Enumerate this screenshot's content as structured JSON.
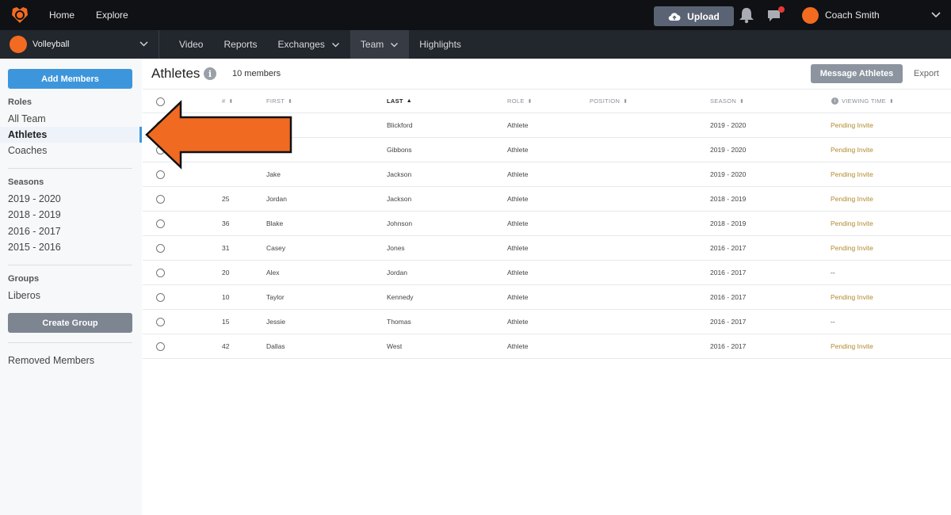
{
  "topbar": {
    "nav": [
      "Home",
      "Explore"
    ],
    "upload_label": "Upload",
    "user_name": "Coach Smith"
  },
  "subbar": {
    "team_name": "Volleyball",
    "nav": [
      {
        "label": "Video",
        "dropdown": false,
        "active": false
      },
      {
        "label": "Reports",
        "dropdown": false,
        "active": false
      },
      {
        "label": "Exchanges",
        "dropdown": true,
        "active": false
      },
      {
        "label": "Team",
        "dropdown": true,
        "active": true
      },
      {
        "label": "Highlights",
        "dropdown": false,
        "active": false
      }
    ]
  },
  "sidebar": {
    "add_members_label": "Add Members",
    "roles_heading": "Roles",
    "roles": [
      "All Team",
      "Athletes",
      "Coaches"
    ],
    "seasons_heading": "Seasons",
    "seasons": [
      "2019 - 2020",
      "2018 - 2019",
      "2016 - 2017",
      "2015 - 2016"
    ],
    "groups_heading": "Groups",
    "groups": [
      "Liberos"
    ],
    "create_group_label": "Create Group",
    "removed_members_label": "Removed Members"
  },
  "main": {
    "title": "Athletes",
    "member_count": "10 members",
    "message_label": "Message Athletes",
    "export_label": "Export",
    "columns": [
      "#",
      "FIRST",
      "LAST",
      "ROLE",
      "POSITION",
      "SEASON",
      "VIEWING TIME"
    ],
    "rows": [
      {
        "num": "",
        "first": "",
        "last": "Blickford",
        "role": "Athlete",
        "position": "",
        "season": "2019 - 2020",
        "viewing": "Pending Invite"
      },
      {
        "num": "",
        "first": "",
        "last": "Gibbons",
        "role": "Athlete",
        "position": "",
        "season": "2019 - 2020",
        "viewing": "Pending Invite"
      },
      {
        "num": "",
        "first": "Jake",
        "last": "Jackson",
        "role": "Athlete",
        "position": "",
        "season": "2019 - 2020",
        "viewing": "Pending Invite"
      },
      {
        "num": "25",
        "first": "Jordan",
        "last": "Jackson",
        "role": "Athlete",
        "position": "",
        "season": "2018 - 2019",
        "viewing": "Pending Invite"
      },
      {
        "num": "36",
        "first": "Blake",
        "last": "Johnson",
        "role": "Athlete",
        "position": "",
        "season": "2018 - 2019",
        "viewing": "Pending Invite"
      },
      {
        "num": "31",
        "first": "Casey",
        "last": "Jones",
        "role": "Athlete",
        "position": "",
        "season": "2016 - 2017",
        "viewing": "Pending Invite"
      },
      {
        "num": "20",
        "first": "Alex",
        "last": "Jordan",
        "role": "Athlete",
        "position": "",
        "season": "2016 - 2017",
        "viewing": "--"
      },
      {
        "num": "10",
        "first": "Taylor",
        "last": "Kennedy",
        "role": "Athlete",
        "position": "",
        "season": "2016 - 2017",
        "viewing": "Pending Invite"
      },
      {
        "num": "15",
        "first": "Jessie",
        "last": "Thomas",
        "role": "Athlete",
        "position": "",
        "season": "2016 - 2017",
        "viewing": "--"
      },
      {
        "num": "42",
        "first": "Dallas",
        "last": "West",
        "role": "Athlete",
        "position": "",
        "season": "2016 - 2017",
        "viewing": "Pending Invite"
      }
    ]
  },
  "colors": {
    "topbar": "#0f1115",
    "subbar": "#22262d",
    "accent_blue": "#3d96dc",
    "brand_orange": "#f26b21",
    "pending": "#b08a2e"
  }
}
